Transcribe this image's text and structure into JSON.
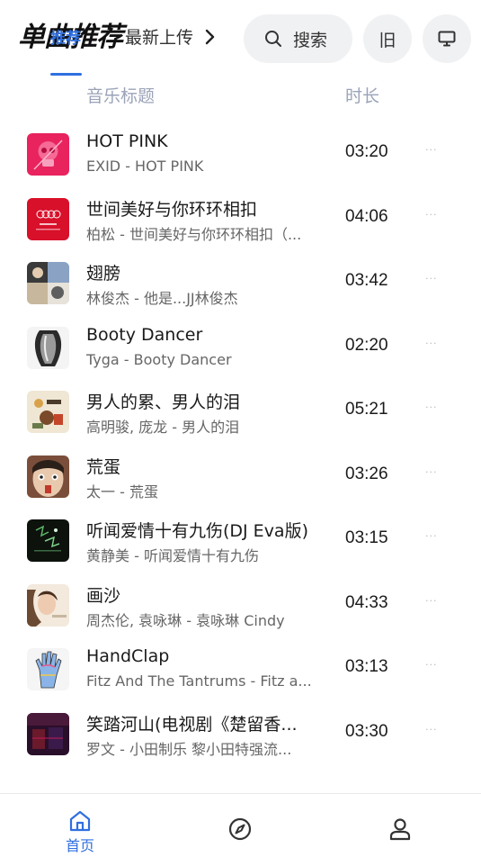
{
  "header": {
    "title": "单曲推荐",
    "active_tab": "推荐",
    "next_tab": "最新上传",
    "search_label": "搜索",
    "old_label": "旧"
  },
  "columns": {
    "title": "音乐标题",
    "duration": "时长"
  },
  "songs": [
    {
      "title": "HOT PINK",
      "subtitle": "EXID - HOT PINK",
      "duration": "03:20",
      "more": "···",
      "cover": "pink-skull"
    },
    {
      "title": "世间美好与你环环相扣",
      "subtitle": "柏松 - 世间美好与你环环相扣（...",
      "duration": "04:06",
      "more": "···",
      "cover": "red-audi"
    },
    {
      "title": "翅膀",
      "subtitle": "林俊杰 - 他是...JJ林俊杰",
      "duration": "03:42",
      "more": "···",
      "cover": "collage"
    },
    {
      "title": "Booty Dancer",
      "subtitle": "Tyga - Booty Dancer",
      "duration": "02:20",
      "more": "···",
      "cover": "chrome-body"
    },
    {
      "title": "男人的累、男人的泪",
      "subtitle": "高明骏, 庞龙 - 男人的泪",
      "duration": "05:21",
      "more": "···",
      "cover": "beige-art"
    },
    {
      "title": "荒蛋",
      "subtitle": "太一 - 荒蛋",
      "duration": "03:26",
      "more": "···",
      "cover": "face"
    },
    {
      "title": "听闻爱情十有九伤(DJ Eva版)",
      "subtitle": "黄静美 - 听闻爱情十有九伤",
      "duration": "03:15",
      "more": "···",
      "cover": "dark-green"
    },
    {
      "title": "画沙",
      "subtitle": "周杰伦, 袁咏琳 - 袁咏琳 Cindy",
      "duration": "04:33",
      "more": "···",
      "cover": "portrait"
    },
    {
      "title": "HandClap",
      "subtitle": "Fitz And The Tantrums - Fitz a...",
      "duration": "03:13",
      "more": "···",
      "cover": "hand"
    },
    {
      "title": "笑踏河山(电视剧《楚留香...",
      "subtitle": "罗文 - 小田制乐 黎小田特强流...",
      "duration": "03:30",
      "more": "···",
      "cover": "purple-dark"
    }
  ],
  "nav": {
    "home_label": "首页"
  },
  "colors": {
    "accent": "#2f6fe0",
    "column_header": "#9aa3b8",
    "pill_bg": "#f0f1f3"
  }
}
